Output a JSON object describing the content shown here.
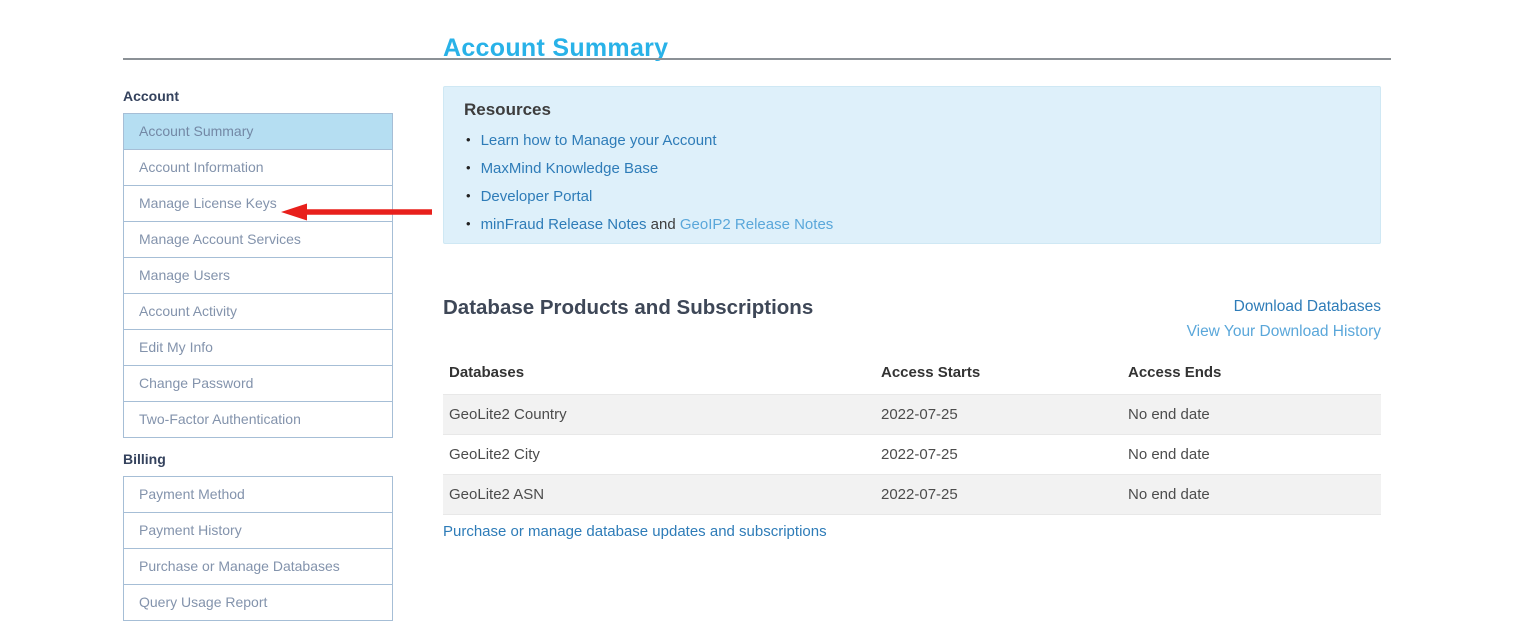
{
  "page_title": "Account Summary",
  "sidebar": {
    "account_heading": "Account",
    "account_items": [
      "Account Summary",
      "Account Information",
      "Manage License Keys",
      "Manage Account Services",
      "Manage Users",
      "Account Activity",
      "Edit My Info",
      "Change Password",
      "Two-Factor Authentication"
    ],
    "selected_item": "Account Summary",
    "billing_heading": "Billing",
    "billing_items": [
      "Payment Method",
      "Payment History",
      "Purchase or Manage Databases",
      "Query Usage Report"
    ]
  },
  "resources": {
    "heading": "Resources",
    "bullet": "•",
    "links": [
      "Learn how to Manage your Account",
      "MaxMind Knowledge Base",
      "Developer Portal"
    ],
    "release_notes": {
      "minfraud": "minFraud Release Notes",
      "connector": " and ",
      "geoip2": "GeoIP2 Release Notes"
    }
  },
  "databases_section": {
    "heading": "Database Products and Subscriptions",
    "download_link": "Download Databases",
    "history_link": "View Your Download History",
    "table": {
      "headers": [
        "Databases",
        "Access Starts",
        "Access Ends"
      ],
      "rows": [
        [
          "GeoLite2 Country",
          "2022-07-25",
          "No end date"
        ],
        [
          "GeoLite2 City",
          "2022-07-25",
          "No end date"
        ],
        [
          "GeoLite2 ASN",
          "2022-07-25",
          "No end date"
        ]
      ]
    },
    "purchase_link": "Purchase or manage database updates and subscriptions"
  },
  "annotation": {
    "arrow_points_to": "Manage License Keys",
    "arrow_color": "#e8201c"
  },
  "colors": {
    "title_blue": "#29b2e8",
    "link_blue": "#2e7cb8",
    "link_light_blue": "#5aa7da",
    "sidebar_selected_bg": "#b5def2",
    "sidebar_border": "#a6bed6",
    "resources_bg": "#def0fa",
    "table_stripe": "#f2f2f2",
    "arrow_red": "#e8201c"
  }
}
